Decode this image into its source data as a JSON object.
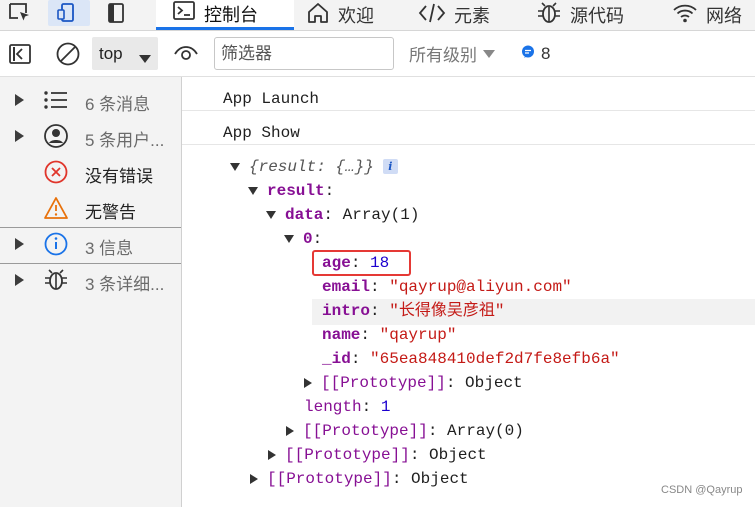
{
  "tabbar": {
    "tabs": [
      {
        "label": "控制台",
        "icon": "console-icon",
        "active": true
      },
      {
        "label": "欢迎",
        "icon": "home-icon",
        "active": false
      },
      {
        "label": "元素",
        "icon": "code-brackets-icon",
        "active": false
      },
      {
        "label": "源代码",
        "icon": "bug-icon",
        "active": false
      },
      {
        "label": "网络",
        "icon": "wifi-icon",
        "active": false
      }
    ],
    "left_icons": [
      "inspect-element-icon",
      "device-toolbar-icon",
      "panel-toggle-icon"
    ],
    "accent_color": "#1a73e8"
  },
  "toolbar": {
    "context_value": "top",
    "filter_placeholder": "筛选器",
    "levels_label": "所有级别",
    "message_count": "8"
  },
  "sidebar": {
    "items": [
      {
        "label": "6 条消息",
        "icon": "list-icon",
        "expandable": true
      },
      {
        "label": "5 条用户...",
        "icon": "user-icon",
        "expandable": true
      },
      {
        "label": "没有错误",
        "icon": "error-icon",
        "expandable": false
      },
      {
        "label": "无警告",
        "icon": "warning-icon",
        "expandable": false
      },
      {
        "label": "3 信息",
        "icon": "info-icon",
        "expandable": true
      },
      {
        "label": "3 条详细...",
        "icon": "bug-icon",
        "expandable": true
      }
    ]
  },
  "console": {
    "lines": [
      "App Launch",
      "App Show"
    ],
    "tree": {
      "root_preview": "{result: {…}}",
      "result_key": "result",
      "data_key": "data",
      "data_value": "Array(1)",
      "index_key": "0",
      "fields": [
        {
          "key": "age",
          "value": "18",
          "type": "number"
        },
        {
          "key": "email",
          "value": "\"qayrup@aliyun.com\"",
          "type": "string"
        },
        {
          "key": "intro",
          "value": "\"长得像吴彦祖\"",
          "type": "string"
        },
        {
          "key": "name",
          "value": "\"qayrup\"",
          "type": "string"
        },
        {
          "key": "_id",
          "value": "\"65ea848410def2d7fe8efb6a\"",
          "type": "string"
        }
      ],
      "proto_object": "[[Prototype]]",
      "proto_object_value": "Object",
      "length_key": "length",
      "length_value": "1",
      "proto_array_value": "Array(0)"
    }
  },
  "watermark": "CSDN @Qayrup"
}
